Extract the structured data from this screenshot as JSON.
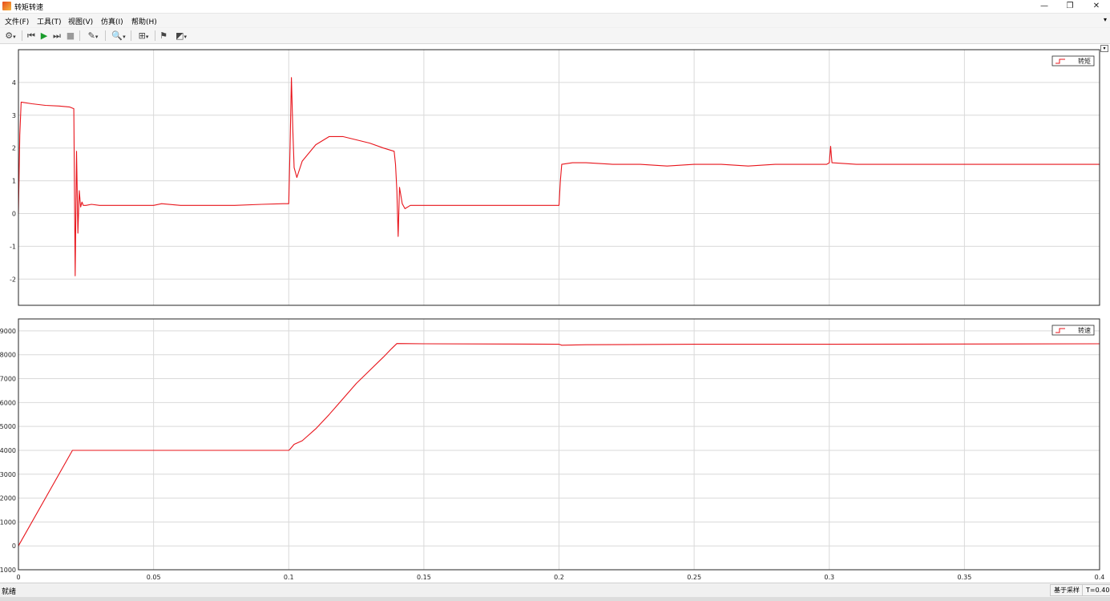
{
  "window": {
    "title": "转矩转速",
    "minimize_glyph": "—",
    "restore_glyph": "❐",
    "close_glyph": "✕"
  },
  "menu": {
    "items": [
      "文件(F)",
      "工具(T)",
      "视图(V)",
      "仿真(I)",
      "帮助(H)"
    ],
    "more_glyph": "▾"
  },
  "toolbar": {
    "icons": [
      "gear-icon",
      "step-back-icon",
      "run-icon",
      "step-forward-icon",
      "stop-icon",
      "highlight-icon",
      "zoom-icon",
      "fit-axes-icon",
      "cursor-measure-icon",
      "style-edit-icon"
    ]
  },
  "status": {
    "left": "就绪",
    "sample_mode": "基于采样",
    "time": "T=0.400"
  },
  "colors": {
    "signal": "#e8141b",
    "grid": "#d9d9d9",
    "axes": "#262626"
  },
  "chart_data": [
    {
      "type": "line",
      "title": "",
      "xlabel": "",
      "ylabel": "",
      "xlim": [
        0,
        0.4
      ],
      "ylim": [
        -2.8,
        5
      ],
      "yticks": [
        -2,
        -1,
        0,
        1,
        2,
        3,
        4
      ],
      "xticks": [
        0,
        0.05,
        0.1,
        0.15,
        0.2,
        0.25,
        0.3,
        0.35,
        0.4
      ],
      "grid": true,
      "legend": "top-right",
      "series": [
        {
          "name": "转矩",
          "x": [
            0,
            0.0005,
            0.001,
            0.005,
            0.01,
            0.015,
            0.019,
            0.0205,
            0.021,
            0.0215,
            0.022,
            0.0225,
            0.023,
            0.0235,
            0.024,
            0.025,
            0.027,
            0.03,
            0.04,
            0.05,
            0.053,
            0.06,
            0.07,
            0.08,
            0.09,
            0.098,
            0.1,
            0.1005,
            0.101,
            0.1015,
            0.102,
            0.103,
            0.105,
            0.11,
            0.115,
            0.12,
            0.125,
            0.13,
            0.135,
            0.139,
            0.1395,
            0.14,
            0.1405,
            0.141,
            0.142,
            0.143,
            0.145,
            0.15,
            0.16,
            0.17,
            0.18,
            0.19,
            0.199,
            0.2,
            0.2005,
            0.201,
            0.205,
            0.21,
            0.22,
            0.23,
            0.24,
            0.25,
            0.26,
            0.27,
            0.28,
            0.29,
            0.299,
            0.3,
            0.3005,
            0.301,
            0.31,
            0.32,
            0.33,
            0.34,
            0.35,
            0.36,
            0.37,
            0.38,
            0.39,
            0.4
          ],
          "y": [
            0,
            2.4,
            3.4,
            3.35,
            3.3,
            3.28,
            3.25,
            3.2,
            -1.9,
            1.9,
            -0.6,
            0.7,
            0.2,
            0.35,
            0.25,
            0.25,
            0.28,
            0.25,
            0.25,
            0.25,
            0.3,
            0.25,
            0.25,
            0.25,
            0.28,
            0.3,
            0.3,
            2.0,
            4.15,
            2.6,
            1.4,
            1.1,
            1.6,
            2.1,
            2.35,
            2.35,
            2.25,
            2.15,
            2.0,
            1.9,
            1.5,
            0.7,
            -0.7,
            0.8,
            0.3,
            0.15,
            0.25,
            0.25,
            0.25,
            0.25,
            0.25,
            0.25,
            0.25,
            0.25,
            1.0,
            1.5,
            1.55,
            1.55,
            1.5,
            1.5,
            1.45,
            1.5,
            1.5,
            1.45,
            1.5,
            1.5,
            1.5,
            1.55,
            2.05,
            1.55,
            1.5,
            1.5,
            1.5,
            1.5,
            1.5,
            1.5,
            1.5,
            1.5,
            1.5,
            1.5
          ]
        }
      ]
    },
    {
      "type": "line",
      "title": "",
      "xlabel": "",
      "ylabel": "",
      "xlim": [
        0,
        0.4
      ],
      "ylim": [
        -1000,
        9500
      ],
      "yticks": [
        -1000,
        0,
        1000,
        2000,
        3000,
        4000,
        5000,
        6000,
        7000,
        8000,
        9000
      ],
      "xticks": [
        0,
        0.05,
        0.1,
        0.15,
        0.2,
        0.25,
        0.3,
        0.35,
        0.4
      ],
      "xtick_labels": [
        "0",
        "0.05",
        "0.1",
        "0.15",
        "0.2",
        "0.25",
        "0.3",
        "0.35",
        "0.4"
      ],
      "grid": true,
      "legend": "top-right",
      "series": [
        {
          "name": "转速",
          "x": [
            0,
            0.02,
            0.021,
            0.05,
            0.1,
            0.1005,
            0.102,
            0.105,
            0.11,
            0.115,
            0.12,
            0.125,
            0.13,
            0.135,
            0.138,
            0.14,
            0.15,
            0.18,
            0.199,
            0.2,
            0.201,
            0.21,
            0.25,
            0.3,
            0.35,
            0.4
          ],
          "y": [
            0,
            4000,
            4000,
            4000,
            4000,
            4050,
            4250,
            4400,
            4900,
            5500,
            6150,
            6800,
            7350,
            7900,
            8250,
            8470,
            8460,
            8450,
            8440,
            8440,
            8400,
            8420,
            8440,
            8440,
            8450,
            8460
          ]
        }
      ]
    }
  ]
}
